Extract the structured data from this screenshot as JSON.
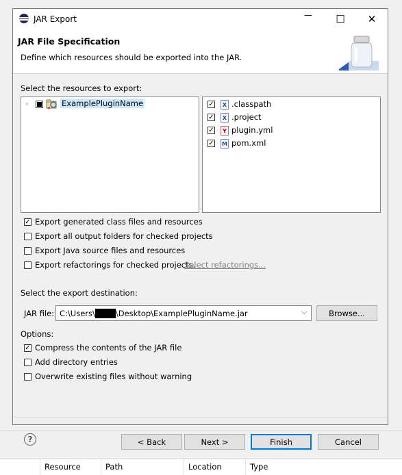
{
  "window": {
    "title": "JAR Export",
    "minimize_glyph": "—",
    "maximize_glyph": "☐",
    "close_glyph": "✕"
  },
  "banner": {
    "title": "JAR File Specification",
    "description": "Define which resources should be exported into the JAR."
  },
  "resources": {
    "label": "Select the resources to export:",
    "tree": [
      {
        "label": "ExamplePluginName",
        "checked": "partial",
        "expanded": false
      }
    ],
    "files": [
      {
        "label": ".classpath",
        "checked": true,
        "icon": "X"
      },
      {
        "label": ".project",
        "checked": true,
        "icon": "X"
      },
      {
        "label": "plugin.yml",
        "checked": true,
        "icon": "Y"
      },
      {
        "label": "pom.xml",
        "checked": true,
        "icon": "M"
      }
    ]
  },
  "options_top": [
    {
      "label": "Export generated class files and resources",
      "checked": true
    },
    {
      "label": "Export all output folders for checked projects",
      "checked": false
    },
    {
      "label": "Export Java source files and resources",
      "checked": false
    },
    {
      "label": "Export refactorings for checked projects.",
      "checked": false
    }
  ],
  "select_refactorings_link": "Select refactorings...",
  "destination": {
    "label": "Select the export destination:",
    "jar_file_label": "JAR file:",
    "path_prefix": "C:\\Users\\",
    "path_suffix": "\\Desktop\\ExamplePluginName.jar",
    "browse_label": "Browse..."
  },
  "options": {
    "label": "Options:",
    "items": [
      {
        "label": "Compress the contents of the JAR file",
        "checked": true
      },
      {
        "label": "Add directory entries",
        "checked": false
      },
      {
        "label": "Overwrite existing files without warning",
        "checked": false
      }
    ]
  },
  "buttons": {
    "back": "< Back",
    "next": "Next >",
    "finish": "Finish",
    "cancel": "Cancel",
    "help_glyph": "?"
  },
  "bottom_table": {
    "columns": [
      "Resource",
      "Path",
      "Location",
      "Type"
    ]
  },
  "colors": {
    "accent": "#0078d7",
    "selection": "#cce8ff"
  }
}
